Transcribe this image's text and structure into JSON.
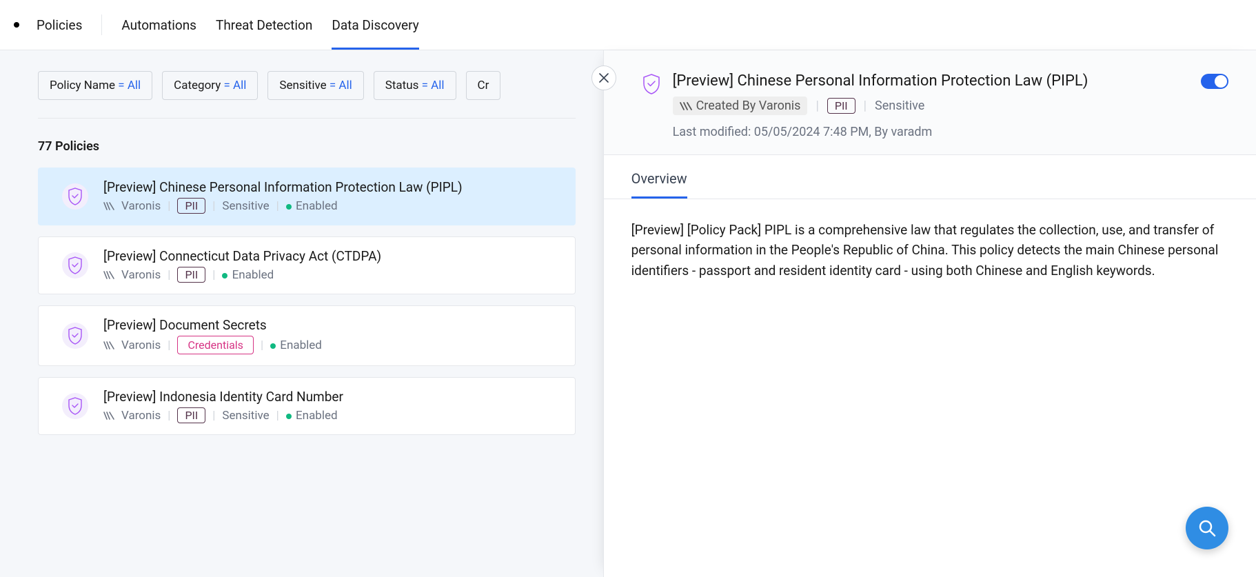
{
  "nav": {
    "items": [
      "Policies",
      "Automations",
      "Threat Detection",
      "Data Discovery"
    ],
    "active_index": 3
  },
  "filters": [
    {
      "label": "Policy Name",
      "value": "= All"
    },
    {
      "label": "Category",
      "value": "= All"
    },
    {
      "label": "Sensitive",
      "value": "= All"
    },
    {
      "label": "Status",
      "value": "= All"
    },
    {
      "label": "Cr",
      "value": ""
    }
  ],
  "policies_count": "77 Policies",
  "policies": [
    {
      "title": "[Preview] Chinese Personal Information Protection Law (PIPL)",
      "creator": "Varonis",
      "tag": "PII",
      "tag_style": "pii",
      "sensitive": "Sensitive",
      "enabled": "Enabled",
      "selected": true
    },
    {
      "title": "[Preview] Connecticut Data Privacy Act (CTDPA)",
      "creator": "Varonis",
      "tag": "PII",
      "tag_style": "pii",
      "sensitive": "",
      "enabled": "Enabled",
      "selected": false
    },
    {
      "title": "[Preview] Document Secrets",
      "creator": "Varonis",
      "tag": "Credentials",
      "tag_style": "cred",
      "sensitive": "",
      "enabled": "Enabled",
      "selected": false
    },
    {
      "title": "[Preview] Indonesia Identity Card Number",
      "creator": "Varonis",
      "tag": "PII",
      "tag_style": "pii",
      "sensitive": "Sensitive",
      "enabled": "Enabled",
      "selected": false
    }
  ],
  "detail": {
    "title": "[Preview] Chinese Personal Information Protection Law (PIPL)",
    "created_by": "Created By Varonis",
    "tag": "PII",
    "sensitive": "Sensitive",
    "last_modified": "Last modified: 05/05/2024 7:48 PM, By varadm",
    "tab": "Overview",
    "body": "[Preview] [Policy Pack] PIPL is a comprehensive law that regulates the collection, use, and transfer of personal information in the People's Republic of China. This policy detects the main Chinese personal identifiers - passport and resident identity card - using both Chinese and English keywords."
  }
}
